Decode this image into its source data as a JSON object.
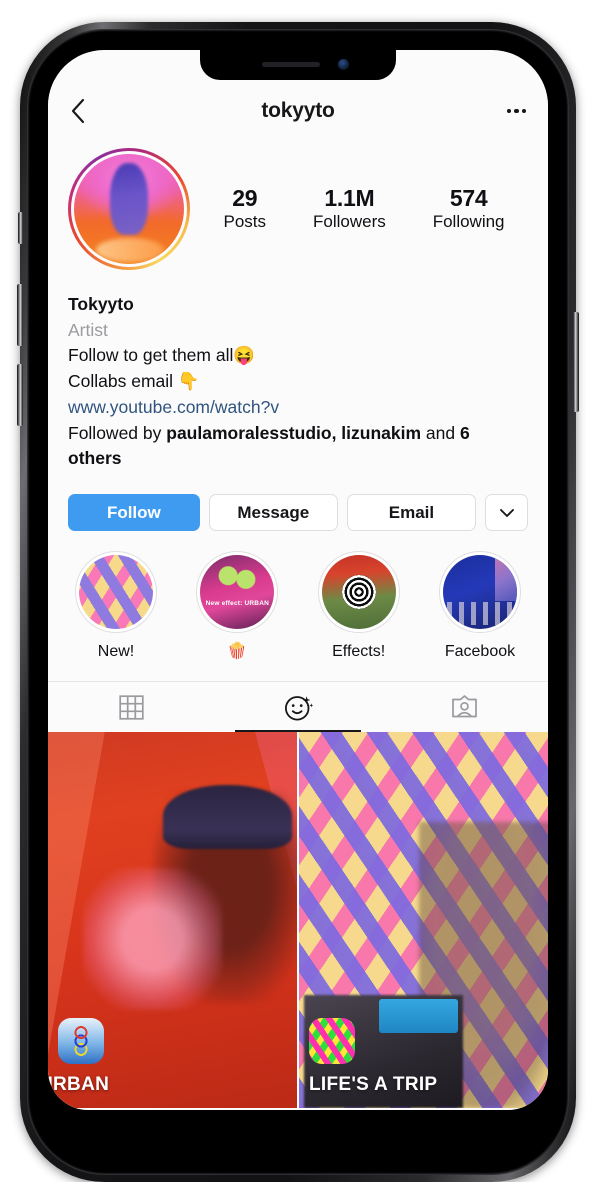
{
  "header": {
    "title": "tokyyto",
    "back_icon": "chevron-left-icon",
    "more_icon": "more-options-icon"
  },
  "profile": {
    "avatar_alt": "profile-photo",
    "stats": [
      {
        "value": "29",
        "label": "Posts"
      },
      {
        "value": "1.1M",
        "label": "Followers"
      },
      {
        "value": "574",
        "label": "Following"
      }
    ],
    "bio": {
      "name": "Tokyyto",
      "category": "Artist",
      "line1": "Follow to get them all😝",
      "line2": "Collabs email 👇",
      "link": "www.youtube.com/watch?v",
      "followed_by_prefix": "Followed by ",
      "followed_by_names": "paulamoralesstudio, lizunakim",
      "followed_by_middle": " and ",
      "followed_by_others": "6 others"
    }
  },
  "actions": {
    "follow": "Follow",
    "message": "Message",
    "email": "Email",
    "dropdown_icon": "chevron-down-icon"
  },
  "highlights": [
    {
      "label": "New!",
      "style": "argyle"
    },
    {
      "label": "🍿",
      "style": "effect",
      "caption": "New effect: URBAN"
    },
    {
      "label": "Effects!",
      "style": "spiral"
    },
    {
      "label": "Facebook",
      "style": "facebook"
    }
  ],
  "tabs": [
    {
      "name": "grid-tab",
      "icon": "grid-icon",
      "active": false
    },
    {
      "name": "effects-tab",
      "icon": "effects-face-icon",
      "active": true
    },
    {
      "name": "tagged-tab",
      "icon": "tagged-person-icon",
      "active": false
    }
  ],
  "media": [
    {
      "title": "URBAN",
      "badge": "urban-effect-icon"
    },
    {
      "title": "LIFE'S A TRIP",
      "badge": "life-is-a-trip-effect-icon"
    }
  ],
  "colors": {
    "follow_blue": "#3e9bf0",
    "link_blue": "#31547f",
    "text_dark": "#101014",
    "muted_gray": "#9a9a9f",
    "border_gray": "#dededf"
  }
}
